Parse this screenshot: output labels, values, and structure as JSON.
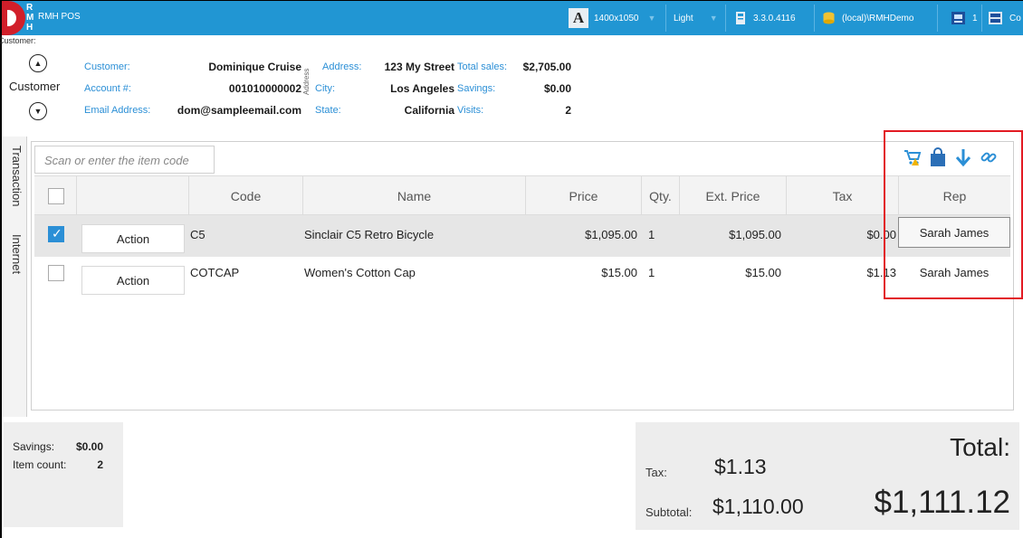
{
  "titlebar": {
    "app_name": "RMH POS",
    "resolution": "1400x1050",
    "theme": "Light",
    "version": "3.3.0.4116",
    "database": "(local)\\RMHDemo",
    "register": "1",
    "truncated_item": "Co",
    "bg_color": "#2196d3"
  },
  "customer": {
    "section_label": "Customer:",
    "button_label": "Customer",
    "name_label": "Customer:",
    "name": "Dominique Cruise",
    "account_label": "Account #:",
    "account": "001010000002",
    "email_label": "Email Address:",
    "email": "dom@sampleemail.com",
    "vertical_label": "Address",
    "address_label": "Address:",
    "address": "123 My Street",
    "city_label": "City:",
    "city": "Los Angeles",
    "state_label": "State:",
    "state": "California",
    "total_sales_label": "Total sales:",
    "total_sales": "$2,705.00",
    "savings_label": "Savings:",
    "savings": "$0.00",
    "visits_label": "Visits:",
    "visits": "2"
  },
  "side_tabs": [
    "Transaction",
    "Internet"
  ],
  "scan": {
    "placeholder": "Scan or enter the item code"
  },
  "table": {
    "headers": [
      "Code",
      "Name",
      "Price",
      "Qty.",
      "Ext. Price",
      "Tax",
      "Rep"
    ],
    "rows": [
      {
        "checked": true,
        "action": "Action",
        "code": "C5",
        "name": "Sinclair C5 Retro Bicycle",
        "price": "$1,095.00",
        "qty": "1",
        "ext_price": "$1,095.00",
        "tax": "$0.00",
        "rep": "Sarah James"
      },
      {
        "checked": false,
        "action": "Action",
        "code": "COTCAP",
        "name": "Women's Cotton Cap",
        "price": "$15.00",
        "qty": "1",
        "ext_price": "$15.00",
        "tax": "$1.13",
        "rep": "Sarah James"
      }
    ]
  },
  "summary": {
    "savings_label": "Savings:",
    "savings": "$0.00",
    "item_count_label": "Item count:",
    "item_count": "2"
  },
  "totals": {
    "tax_label": "Tax:",
    "tax": "$1.13",
    "subtotal_label": "Subtotal:",
    "subtotal": "$1,110.00",
    "total_label": "Total:",
    "total": "$1,111.12"
  },
  "colors": {
    "accent": "#2b8fd6",
    "highlight": "#e21b23",
    "selected_row": "#e6e6e6"
  }
}
